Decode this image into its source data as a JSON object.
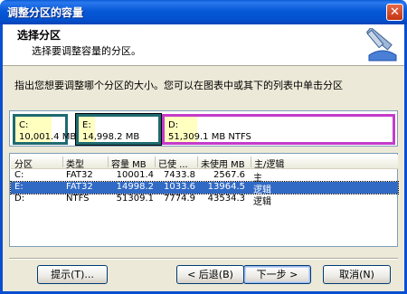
{
  "window": {
    "title": "调整分区的容量",
    "close_glyph": "✕"
  },
  "header": {
    "title": "选择分区",
    "subtitle": "选择要调整容量的分区。",
    "icon": "resize-wizard-icon"
  },
  "instruction": "指出您想要调整哪个分区的大小。您可以在图表中或其下的列表中单击分区",
  "diagram": {
    "partitions": [
      {
        "name": "C:",
        "info": "10,001.4 MB"
      },
      {
        "name": "E:",
        "info": "14,998.2 MB"
      },
      {
        "name": "D:",
        "info": "51,309.1 MB   NTFS"
      }
    ]
  },
  "table": {
    "columns": [
      "分区",
      "类型",
      "容量 MB",
      "已使 ...",
      "未使用 MB",
      "主/逻辑"
    ],
    "rows": [
      {
        "partition": "C:",
        "type": "FAT32",
        "capacity": "10001.4",
        "used": "7433.8",
        "unused": "2567.6",
        "kind": "主"
      },
      {
        "partition": "E:",
        "type": "FAT32",
        "capacity": "14998.2",
        "used": "1033.6",
        "unused": "13964.5",
        "kind": "逻辑"
      },
      {
        "partition": "D:",
        "type": "NTFS",
        "capacity": "51309.1",
        "used": "7774.9",
        "unused": "43534.3",
        "kind": "逻辑"
      }
    ],
    "selected_row": 1
  },
  "buttons": {
    "hint": "提示(T)...",
    "back": "< 后退(B)",
    "next": "下一步 >",
    "cancel": "取消(N)"
  },
  "colors": {
    "title_bar": "#0a5bd6",
    "selection": "#316ac5",
    "partition_c_e_border": "#1f6a70",
    "partition_d_border": "#c43bc9"
  }
}
